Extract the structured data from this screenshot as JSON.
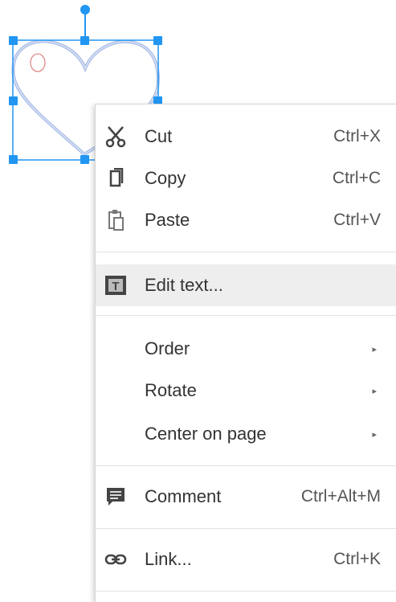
{
  "menu": {
    "cut": {
      "label": "Cut",
      "shortcut": "Ctrl+X",
      "icon": "scissors-icon"
    },
    "copy": {
      "label": "Copy",
      "shortcut": "Ctrl+C",
      "icon": "copy-icon"
    },
    "paste": {
      "label": "Paste",
      "shortcut": "Ctrl+V",
      "icon": "paste-icon"
    },
    "edit": {
      "label": "Edit text...",
      "icon": "text-box-icon"
    },
    "order": {
      "label": "Order",
      "submenu": "▸"
    },
    "rotate": {
      "label": "Rotate",
      "submenu": "▸"
    },
    "center": {
      "label": "Center on page",
      "submenu": "▸"
    },
    "comment": {
      "label": "Comment",
      "shortcut": "Ctrl+Alt+M",
      "icon": "comment-icon"
    },
    "link": {
      "label": "Link...",
      "shortcut": "Ctrl+K",
      "icon": "link-icon"
    }
  },
  "colors": {
    "selection": "#2196f3",
    "heart_stroke": "#a9bde6",
    "highlight": "#eeeeee",
    "text": "#333333"
  }
}
